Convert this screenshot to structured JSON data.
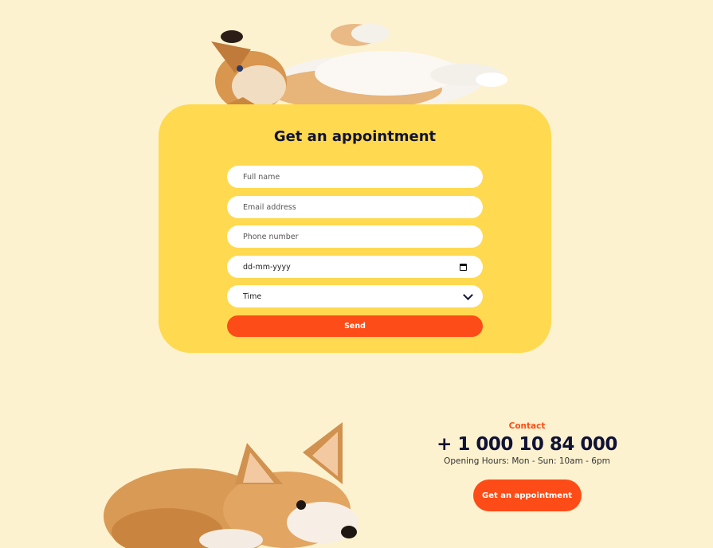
{
  "appointment": {
    "title": "Get an appointment",
    "fields": {
      "full_name": "Full name",
      "email": "Email address",
      "phone": "Phone number",
      "date": "dd-mm-yyyy",
      "time": "Time"
    },
    "send_label": "Send"
  },
  "contact": {
    "label": "Contact",
    "phone": "+ 1 000 10 84 000",
    "hours": "Opening Hours: Mon - Sun: 10am - 6pm",
    "button_label": "Get an appointment"
  },
  "colors": {
    "background": "#fdf2cf",
    "card": "#ffd94f",
    "accent": "#fd4c17",
    "navy": "#101236"
  }
}
